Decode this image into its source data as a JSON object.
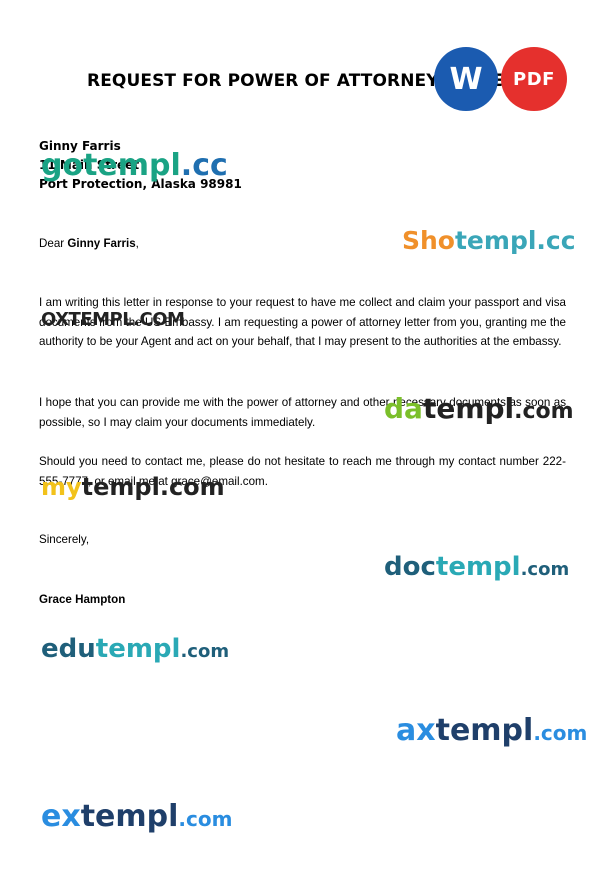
{
  "document": {
    "title": "REQUEST FOR POWER OF ATTORNEY LETTER",
    "recipient": {
      "name": "Ginny Farris",
      "street": "11 Main Street",
      "city_line": "Port Protection, Alaska 98981"
    },
    "salutation_prefix": "Dear",
    "salutation_name": "Ginny Farris",
    "salutation_suffix": ",",
    "paragraphs": [
      "I am writing this letter in response to your request to have me collect and claim your passport and visa documents from the US Embassy. I am requesting a power of attorney letter from you, granting me the authority to be your Agent and act on your behalf, that I may present to the authorities at the embassy.",
      "I hope that you can provide me with the power of attorney and other necessary documents as soon as possible, so I may claim your documents immediately.",
      "Should you need to contact me, please do not hesitate to reach me through my contact number 222-555-7777, or email me at grace@email.com."
    ],
    "closing": "Sincerely,",
    "signature": "Grace Hampton"
  },
  "badges": {
    "word": "W",
    "pdf": "PDF"
  },
  "watermarks": {
    "gotempl": {
      "name": "gotempl",
      "dom": ".cc"
    },
    "shotempl_a": "Sho",
    "shotempl_b": "templ",
    "shotempl_c": ".cc",
    "oxtempl": "OXTEMPL.COM",
    "datempl_a": "da",
    "datempl_b": "templ",
    "datempl_c": ".com",
    "mytempl_a": "my",
    "mytempl_b": "templ",
    "mytempl_c": ".com",
    "doctempl_a": "doc",
    "doctempl_b": "templ",
    "doctempl_c": ".com",
    "edutempl_a": "edu",
    "edutempl_b": "templ",
    "edutempl_c": ".com",
    "axtempl_a": "ax",
    "axtempl_b": "templ",
    "axtempl_c": ".com",
    "extempl_a": "ex",
    "extempl_b": "templ",
    "extempl_c": ".com"
  }
}
